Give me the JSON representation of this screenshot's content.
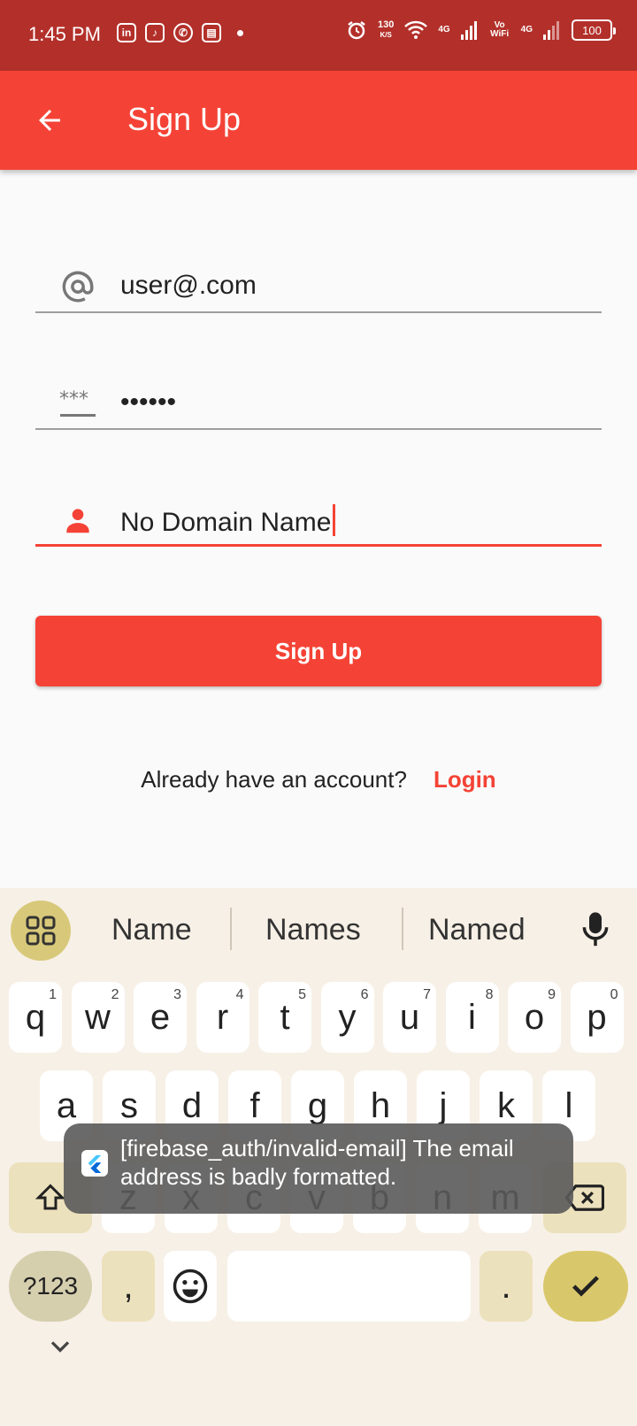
{
  "status_bar": {
    "time": "1:45 PM",
    "net_speed": "130",
    "net_unit": "K/S",
    "sig1_label": "4G",
    "vowifi_label": "Vo WiFi",
    "sig2_label": "4G",
    "battery": "100"
  },
  "app_bar": {
    "title": "Sign Up"
  },
  "form": {
    "email_value": "user@.com",
    "password_value": "••••••",
    "name_value": "No Domain Name",
    "accent_color": "#f44336"
  },
  "signup_button": {
    "label": "Sign Up"
  },
  "account_prompt": {
    "text": "Already have an account?",
    "link": "Login"
  },
  "keyboard": {
    "suggestions": [
      "Name",
      "Names",
      "Named"
    ],
    "row1": [
      {
        "k": "q",
        "n": "1"
      },
      {
        "k": "w",
        "n": "2"
      },
      {
        "k": "e",
        "n": "3"
      },
      {
        "k": "r",
        "n": "4"
      },
      {
        "k": "t",
        "n": "5"
      },
      {
        "k": "y",
        "n": "6"
      },
      {
        "k": "u",
        "n": "7"
      },
      {
        "k": "i",
        "n": "8"
      },
      {
        "k": "o",
        "n": "9"
      },
      {
        "k": "p",
        "n": "0"
      }
    ],
    "row2": [
      "a",
      "s",
      "d",
      "f",
      "g",
      "h",
      "j",
      "k",
      "l"
    ],
    "row3": [
      "z",
      "x",
      "c",
      "v",
      "b",
      "n",
      "m"
    ],
    "symbols_label": "?123",
    "comma_label": ",",
    "period_label": "."
  },
  "toast": {
    "message": "[firebase_auth/invalid-email] The email address is badly formatted."
  }
}
